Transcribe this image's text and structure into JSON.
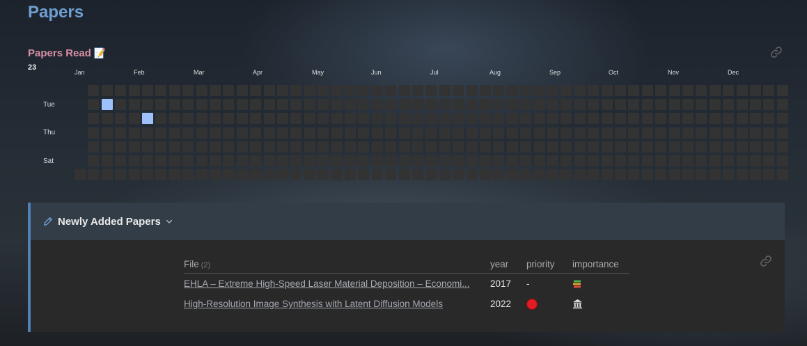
{
  "page": {
    "title": "Papers"
  },
  "heatmap": {
    "title": "Papers Read",
    "title_emoji": "📝",
    "count": "23",
    "months": [
      "Jan",
      "Feb",
      "Mar",
      "Apr",
      "May",
      "Jun",
      "Jul",
      "Aug",
      "Sep",
      "Oct",
      "Nov",
      "Dec"
    ],
    "day_labels": [
      "Tue",
      "Thu",
      "Sat"
    ],
    "active_cells": [
      {
        "week": 2,
        "day": 1
      },
      {
        "week": 5,
        "day": 2
      }
    ],
    "colors": {
      "empty": "#333333",
      "active": "#9ec0fb"
    }
  },
  "callout": {
    "title": "Newly Added Papers",
    "table": {
      "headers": {
        "file": "File",
        "count": "(2)",
        "year": "year",
        "priority": "priority",
        "importance": "importance"
      },
      "rows": [
        {
          "file": "EHLA – Extreme High-Speed Laser Material Deposition – Economi...",
          "year": "2017",
          "priority": "-",
          "importance_icon": "books-icon"
        },
        {
          "file": "High-Resolution Image Synthesis with Latent Diffusion Models",
          "year": "2022",
          "priority_icon": "red-circle-icon",
          "importance_icon": "classical-building-icon"
        }
      ]
    }
  }
}
